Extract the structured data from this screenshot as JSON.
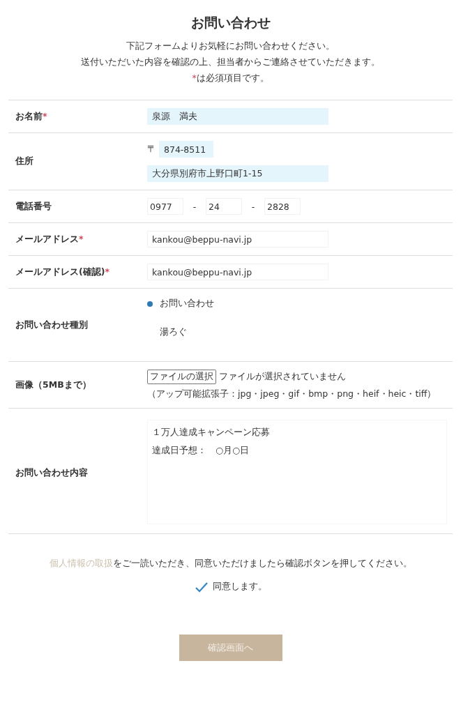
{
  "title": "お問い合わせ",
  "intro": [
    "下記フォームよりお気軽にお問い合わせください。",
    "送付いただいた内容を確認の上、担当者からご連絡させていただきます。"
  ],
  "required_note": {
    "mark": "*",
    "text": "は必須項目です。"
  },
  "rows": [
    {
      "kind": "text",
      "label": "お名前",
      "mark": "*",
      "value": "泉源　満夫",
      "autofilled": true
    },
    {
      "kind": "address",
      "label": "住所",
      "prefix": "〒",
      "zip": "874-8511",
      "zip_autofilled": true,
      "value": "大分県別府市上野口町1-15",
      "autofilled": true
    },
    {
      "kind": "phone",
      "label": "電話番号",
      "parts": [
        "0977",
        "24",
        "2828"
      ],
      "separator": "-"
    },
    {
      "kind": "text",
      "label": "メールアドレス",
      "mark": "*",
      "value": "kankou@beppu-navi.jp",
      "autofilled": false
    },
    {
      "kind": "text",
      "label": "メールアドレス(確認)",
      "mark": "*",
      "value": "kankou@beppu-navi.jp",
      "autofilled": false
    },
    {
      "kind": "radio",
      "label": "お問い合わせ種別",
      "options": [
        {
          "label": "お問い合わせ",
          "selected": true
        },
        {
          "label": "湯ろぐ",
          "selected": false
        }
      ]
    },
    {
      "kind": "file",
      "label": "画像（5MBまで）",
      "button": "ファイルの選択",
      "status": "ファイルが選択されていません",
      "hint": "（アップ可能拡張子：jpg・jpeg・gif・bmp・png・heif・heic・tiff）"
    },
    {
      "kind": "textarea",
      "label": "お問い合わせ内容",
      "lines": [
        "１万人達成キャンペーン応募",
        "達成日予想：　○月○日"
      ]
    }
  ],
  "consent": {
    "link": "個人情報の取扱",
    "text": "をご一読いただき、同意いただけましたら確認ボタンを押してください。",
    "checked": true,
    "label": "同意します。"
  },
  "submit": "確認画面へ"
}
